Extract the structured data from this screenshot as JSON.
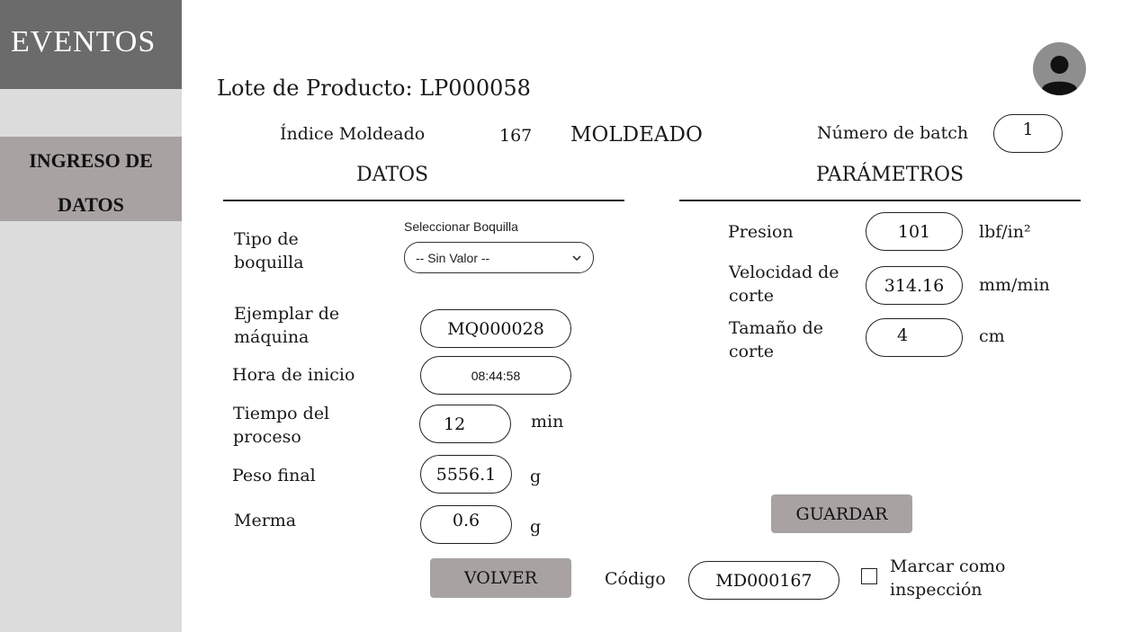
{
  "sidebar": {
    "brand": "EVENTOS",
    "nav": [
      {
        "line1": "INGRESO DE",
        "line2": "DATOS",
        "active": true
      }
    ]
  },
  "header": {
    "lote_label": "Lote de Producto: LP000058",
    "indice_label": "Índice Moldeado",
    "indice_value": "167",
    "stage": "MOLDEADO",
    "batch_label": "Número de batch",
    "batch_value": "1"
  },
  "datos": {
    "title": "DATOS",
    "tipo_boquilla_label": "Tipo de boquilla",
    "boquilla_select_caption": "Seleccionar Boquilla",
    "boquilla_selected": "-- Sin Valor --",
    "ejemplar_label": "Ejemplar de máquina",
    "ejemplar_value": "MQ000028",
    "hora_label": "Hora de inicio",
    "hora_value": "08:44:58",
    "tiempo_label": "Tiempo del proceso",
    "tiempo_value": "12",
    "tiempo_unit": "min",
    "peso_label": "Peso final",
    "peso_value": "5556.1",
    "peso_unit": "g",
    "merma_label": "Merma",
    "merma_value": "0.6",
    "merma_unit": "g"
  },
  "parametros": {
    "title": "PARÁMETROS",
    "presion_label": "Presion",
    "presion_value": "101",
    "presion_unit": "lbf/in²",
    "velocidad_label": "Velocidad de corte",
    "velocidad_value": "314.16",
    "velocidad_unit": "mm/min",
    "tamano_label": "Tamaño de corte",
    "tamano_value": "4",
    "tamano_unit": "cm"
  },
  "actions": {
    "guardar": "GUARDAR",
    "volver": "VOLVER",
    "codigo_label": "Código",
    "codigo_value": "MD000167",
    "inspeccion_label": "Marcar como inspección",
    "inspeccion_checked": false
  },
  "icons": {
    "avatar": "user-avatar-icon",
    "chevron": "chevron-down-icon"
  },
  "colors": {
    "sidebar_bg": "#dcdcdc",
    "brand_bg": "#6b6b6b",
    "active_nav_bg": "#a8a2a2",
    "button_bg": "#a8a2a2",
    "avatar_bg": "#8e8e8e"
  }
}
